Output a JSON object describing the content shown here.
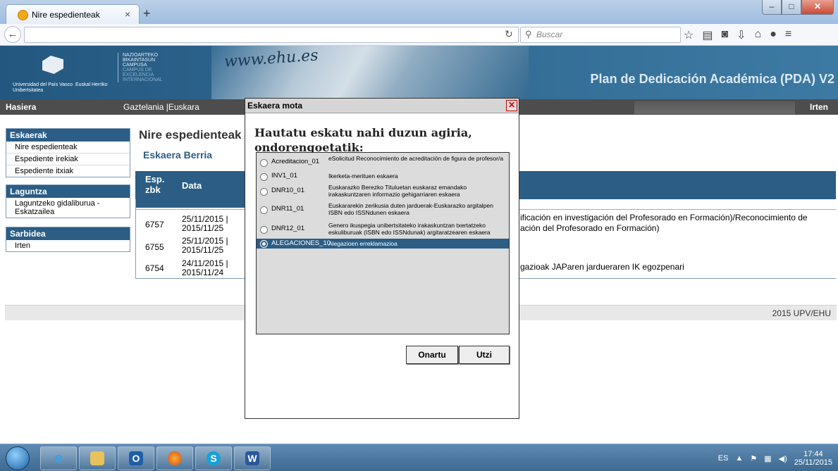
{
  "browser": {
    "tab_title": "Nire espedienteak",
    "search_placeholder": "Buscar"
  },
  "header": {
    "university": "Universidad del País Vasco",
    "university_eu": "Euskal Herriko Unibertsitatea",
    "campus_lines": [
      "NAZIOARTEKO",
      "BIKAINTASUN",
      "CAMPUSA",
      "CAMPUS DE",
      "EXCELENCIA",
      "INTERNACIONAL"
    ],
    "www": "www.ehu.es",
    "app_title": "Plan de Dedicación Académica (PDA) V2"
  },
  "menubar": {
    "home": "Hasiera",
    "lang_es": "Gaztelania",
    "lang_eu": "Euskara",
    "logout": "Irten"
  },
  "sidebar": {
    "eskaerak_title": "Eskaerak",
    "eskaerak_items": [
      "Nire espedienteak",
      "Espediente irekiak",
      "Espediente itxiak"
    ],
    "laguntza_title": "Laguntza",
    "laguntza_items": [
      "Laguntzeko gidaliburua - Eskatzailea"
    ],
    "sarbidea_title": "Sarbidea",
    "sarbidea_items": [
      "Irten"
    ]
  },
  "main": {
    "title": "Nire espedienteak",
    "new_request": "Eskaera Berria",
    "col_id_line1": "Esp.",
    "col_id_line2": "zbk",
    "col_date": "Data",
    "rows": [
      {
        "id": "6757",
        "date1": "25/11/2015 |",
        "date2": "2015/11/25",
        "text": "ificación en investigación del Profesorado en Formación)/Reconocimiento de",
        "text2": "ación del Profesorado en Formación)"
      },
      {
        "id": "6755",
        "date1": "25/11/2015 |",
        "date2": "2015/11/25",
        "text": "",
        "text2": ""
      },
      {
        "id": "6754",
        "date1": "24/11/2015 |",
        "date2": "2015/11/24",
        "text": "gazioak JAParen jardueraren IK egozpenari",
        "text2": ""
      }
    ]
  },
  "footer": {
    "text": "2015 UPV/EHU"
  },
  "dialog": {
    "title": "Eskaera mota",
    "heading_line1": "Hautatu eskatu nahi duzun agiria,",
    "heading_line2": "ondorengoetatik:",
    "options": [
      {
        "code": "Acreditacion_01",
        "desc": "eSolicitud Reconocimiento de acreditación de figura de profesor/a"
      },
      {
        "code": "INV1_01",
        "desc": "Ikerketa-merituen eskaera"
      },
      {
        "code": "DNR10_01",
        "desc": "Euskarazko Berezko Tituluetan euskaraz emandako irakaskuntzaren informazio gehigarriaren eskaera"
      },
      {
        "code": "DNR11_01",
        "desc": "Euskararekin zerikusia duten jarduerak-Euskarazko argitalpen ISBN edo ISSNdunen eskaera"
      },
      {
        "code": "DNR12_01",
        "desc": "Genero ikuspegia unibertsitateko irakaskuntzan txertatzeko eskuliburuak (ISBN edo ISSNdunak) argitaratzearen eskaera"
      },
      {
        "code": "ALEGACIONES_10",
        "desc": "Alegazioen erreklamazioa"
      }
    ],
    "selected_index": 5,
    "ok_label": "Onartu",
    "cancel_label": "Utzi"
  },
  "taskbar": {
    "lang": "ES",
    "time": "17:44",
    "date": "25/11/2015"
  }
}
